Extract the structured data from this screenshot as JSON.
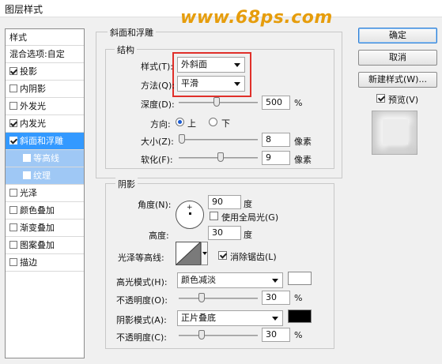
{
  "window": {
    "title": "图层样式",
    "watermark": "www.68ps.com"
  },
  "sidebar": {
    "header": "样式",
    "items": [
      {
        "label": "混合选项:自定",
        "checkbox": false,
        "checked": false
      },
      {
        "label": "投影",
        "checkbox": true,
        "checked": true
      },
      {
        "label": "内阴影",
        "checkbox": true,
        "checked": false
      },
      {
        "label": "外发光",
        "checkbox": true,
        "checked": false
      },
      {
        "label": "内发光",
        "checkbox": true,
        "checked": true
      },
      {
        "label": "斜面和浮雕",
        "checkbox": true,
        "checked": true,
        "selected": true
      },
      {
        "label": "等高线",
        "checkbox": true,
        "checked": false,
        "sub": true
      },
      {
        "label": "纹理",
        "checkbox": true,
        "checked": false,
        "sub": true
      },
      {
        "label": "光泽",
        "checkbox": true,
        "checked": false
      },
      {
        "label": "颜色叠加",
        "checkbox": true,
        "checked": false
      },
      {
        "label": "渐变叠加",
        "checkbox": true,
        "checked": false
      },
      {
        "label": "图案叠加",
        "checkbox": true,
        "checked": false
      },
      {
        "label": "描边",
        "checkbox": true,
        "checked": false
      }
    ]
  },
  "bevel": {
    "group_title": "斜面和浮雕",
    "structure_title": "结构",
    "style_label": "样式(T):",
    "style_value": "外斜面",
    "technique_label": "方法(Q):",
    "technique_value": "平滑",
    "depth_label": "深度(D):",
    "depth_value": "500",
    "depth_level": 0.5,
    "percent": "%",
    "direction_label": "方向:",
    "dir_up": "上",
    "dir_down": "下",
    "direction_selected": "上",
    "size_label": "大小(Z):",
    "size_value": "8",
    "size_level": 0.04,
    "soften_label": "软化(F):",
    "soften_value": "9",
    "soften_level": 0.55,
    "px": "像素"
  },
  "shading": {
    "title": "阴影",
    "angle_label": "角度(N):",
    "angle_value": "90",
    "degree": "度",
    "global_light_label": "使用全局光(G)",
    "global_light_checked": false,
    "altitude_label": "高度:",
    "altitude_value": "30",
    "gloss_label": "光泽等高线:",
    "antialias_label": "消除锯齿(L)",
    "antialias_checked": true,
    "highlight_mode_label": "高光模式(H):",
    "highlight_mode_value": "颜色减淡",
    "highlight_color": "#ffffff",
    "highlight_opacity_label": "不透明度(O):",
    "highlight_opacity_value": "30",
    "highlight_opacity_level": 0.3,
    "shadow_mode_label": "阴影模式(A):",
    "shadow_mode_value": "正片叠底",
    "shadow_color": "#000000",
    "shadow_opacity_label": "不透明度(C):",
    "shadow_opacity_value": "30",
    "shadow_opacity_level": 0.3,
    "percent": "%"
  },
  "buttons": {
    "ok": "确定",
    "cancel": "取消",
    "new_style": "新建样式(W)...",
    "preview_label": "预览(V)",
    "preview_checked": true
  },
  "colors": {
    "selection": "#3399ff",
    "highlight_box": "#e0302a"
  }
}
